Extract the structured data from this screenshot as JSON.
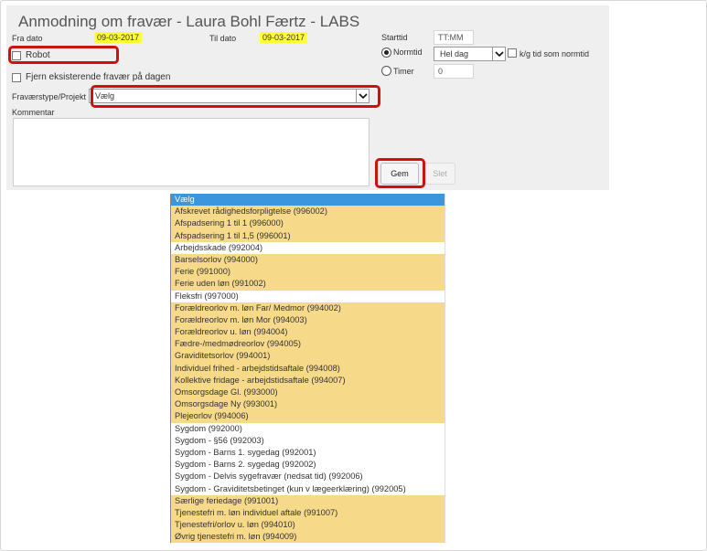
{
  "form": {
    "title": "Anmodning om fravær - Laura Bohl Færtz - LABS",
    "fra_dato_label": "Fra dato",
    "fra_dato_value": "09-03-2017",
    "til_dato_label": "Til dato",
    "til_dato_value": "09-03-2017",
    "robot_label": "Robot",
    "fjern_label": "Fjern eksisterende fravær på dagen",
    "type_label": "Fraværstype/Projekt",
    "type_value": "Vælg",
    "kommentar_label": "Kommentar",
    "starttid_label": "Starttid",
    "starttid_value": "TT:MM",
    "normtid_label": "Normtid",
    "normtid_select": "Hel dag",
    "kg_label": "k/g tid som normtid",
    "timer_label": "Timer",
    "timer_value": "0",
    "gem_label": "Gem",
    "slet_label": "Slet"
  },
  "options": [
    {
      "label": "Vælg",
      "state": "selected"
    },
    {
      "label": "Afskrevet rådighedsforpligtelse (996002)",
      "state": "highlight"
    },
    {
      "label": "Afspadsering 1 til 1 (996000)",
      "state": "highlight"
    },
    {
      "label": "Afspadsering 1 til 1,5 (996001)",
      "state": "highlight"
    },
    {
      "label": "Arbejdsskade (992004)",
      "state": "plain"
    },
    {
      "label": "Barselsorlov (994000)",
      "state": "highlight"
    },
    {
      "label": "Ferie (991000)",
      "state": "highlight"
    },
    {
      "label": "Ferie uden løn (991002)",
      "state": "highlight"
    },
    {
      "label": "Fleksfri (997000)",
      "state": "plain"
    },
    {
      "label": "Forældreorlov m. løn Far/ Medmor (994002)",
      "state": "highlight"
    },
    {
      "label": "Forældreorlov m. løn Mor (994003)",
      "state": "highlight"
    },
    {
      "label": "Forældreorlov u. løn (994004)",
      "state": "highlight"
    },
    {
      "label": "Fædre-/medmødreorlov (994005)",
      "state": "highlight"
    },
    {
      "label": "Graviditetsorlov (994001)",
      "state": "highlight"
    },
    {
      "label": "Individuel frihed - arbejdstidsaftale (994008)",
      "state": "highlight"
    },
    {
      "label": "Kollektive fridage - arbejdstidsaftale (994007)",
      "state": "highlight"
    },
    {
      "label": "Omsorgsdage Gl. (993000)",
      "state": "highlight"
    },
    {
      "label": "Omsorgsdage Ny (993001)",
      "state": "highlight"
    },
    {
      "label": "Plejeorlov (994006)",
      "state": "highlight"
    },
    {
      "label": "Sygdom (992000)",
      "state": "plain"
    },
    {
      "label": "Sygdom - §56 (992003)",
      "state": "plain"
    },
    {
      "label": "Sygdom - Barns 1. sygedag (992001)",
      "state": "plain"
    },
    {
      "label": "Sygdom - Barns 2. sygedag (992002)",
      "state": "plain"
    },
    {
      "label": "Sygdom - Delvis sygefravær (nedsat tid) (992006)",
      "state": "plain"
    },
    {
      "label": "Sygdom - Graviditetsbetinget (kun v lægeerklæring) (992005)",
      "state": "plain"
    },
    {
      "label": "Særlige feriedage (991001)",
      "state": "highlight"
    },
    {
      "label": "Tjenestefri m. løn individuel aftale (991007)",
      "state": "highlight"
    },
    {
      "label": "Tjenestefri/orlov u. løn (994010)",
      "state": "highlight"
    },
    {
      "label": "Øvrig tjenestefri m. løn (994009)",
      "state": "highlight"
    }
  ]
}
